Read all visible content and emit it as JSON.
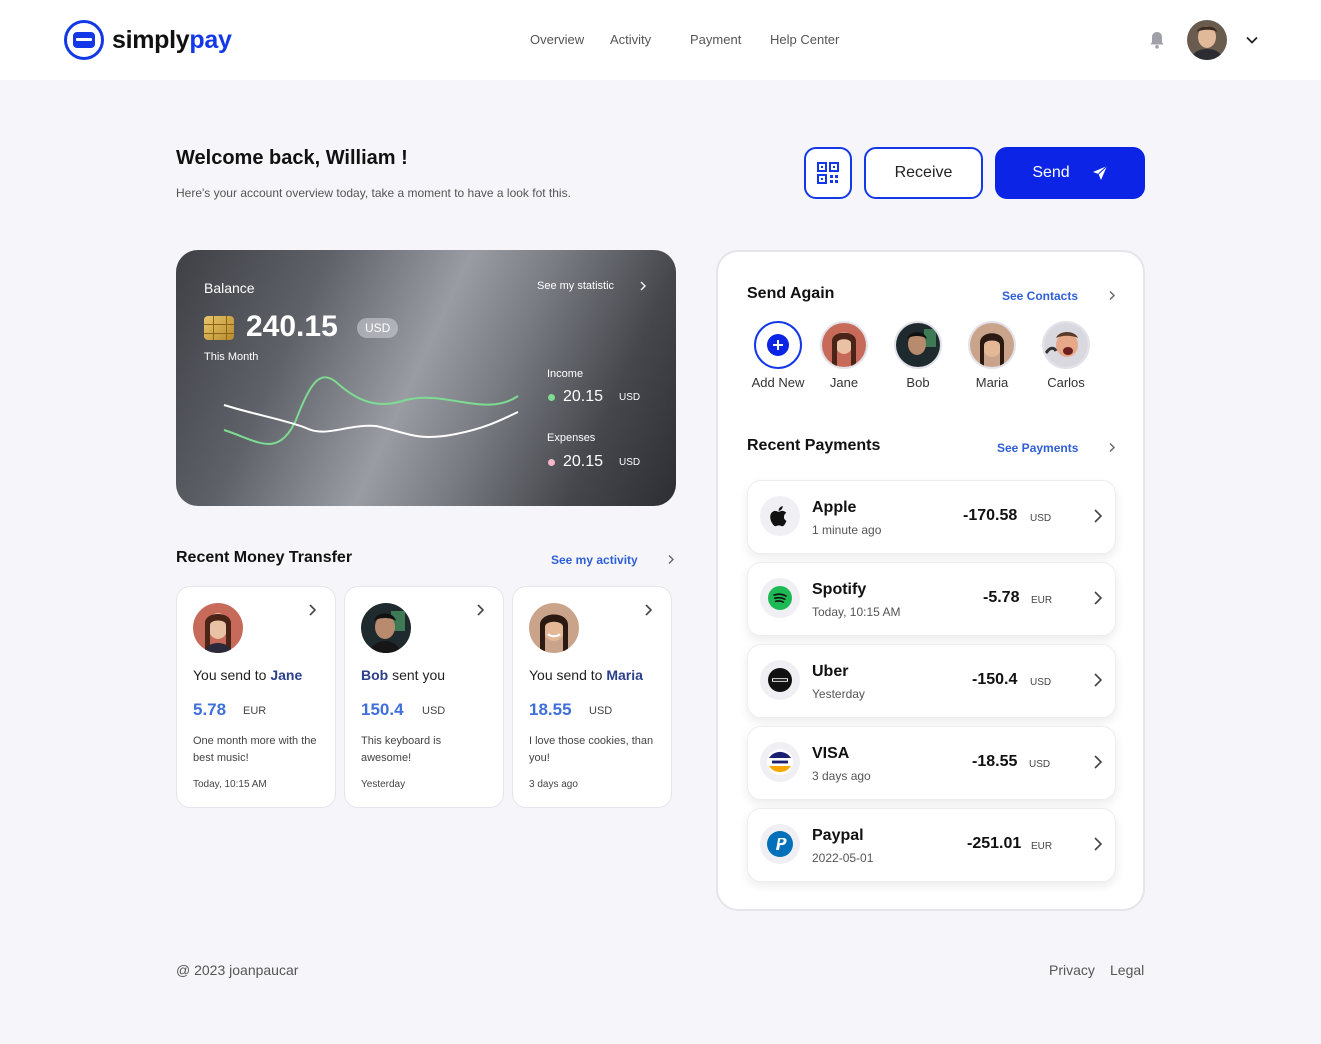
{
  "brand": {
    "part1": "simply",
    "part2": "pay",
    "accent": "#1338e8"
  },
  "nav": {
    "overview": "Overview",
    "activity": "Activity",
    "payment": "Payment",
    "help": "Help Center"
  },
  "header": {
    "welcome": "Welcome back, William !",
    "subtitle": "Here's your account overview today, take a moment to have a look fot this."
  },
  "actions": {
    "receive": "Receive",
    "send": "Send"
  },
  "balance": {
    "label": "Balance",
    "see_stat": "See my statistic",
    "amount": "240.15",
    "currency": "USD",
    "period": "This Month",
    "income_label": "Income",
    "income_value": "20.15",
    "income_currency": "USD",
    "expenses_label": "Expenses",
    "expenses_value": "20.15",
    "expenses_currency": "USD",
    "income_color": "#7ddc92",
    "expenses_color": "#f6b8c8"
  },
  "recent_transfer": {
    "title": "Recent Money Transfer",
    "link": "See my activity",
    "items": [
      {
        "prefix": "You send to ",
        "name": "Jane",
        "suffix": "",
        "amount": "5.78",
        "currency": "EUR",
        "note": "One month more with the best music!",
        "time": "Today, 10:15 AM"
      },
      {
        "prefix": "",
        "name": "Bob",
        "suffix": " sent you",
        "amount": "150.4",
        "currency": "USD",
        "note": "This keyboard is awesome!",
        "time": "Yesterday"
      },
      {
        "prefix": "You send to ",
        "name": "Maria",
        "suffix": "",
        "amount": "18.55",
        "currency": "USD",
        "note": "I love those cookies, than you!",
        "time": "3 days ago"
      }
    ]
  },
  "send_again": {
    "title": "Send Again",
    "link": "See Contacts",
    "contacts": [
      "Add New",
      "Jane",
      "Bob",
      "Maria",
      "Carlos"
    ]
  },
  "recent_payments": {
    "title": "Recent Payments",
    "link": "See Payments",
    "items": [
      {
        "name": "Apple",
        "time": "1 minute ago",
        "value": "-170.58",
        "currency": "USD",
        "icon": "apple-icon"
      },
      {
        "name": "Spotify",
        "time": "Today, 10:15 AM",
        "value": "-5.78",
        "currency": "EUR",
        "icon": "spotify-icon"
      },
      {
        "name": "Uber",
        "time": "Yesterday",
        "value": "-150.4",
        "currency": "USD",
        "icon": "uber-icon"
      },
      {
        "name": "VISA",
        "time": "3 days ago",
        "value": "-18.55",
        "currency": "USD",
        "icon": "visa-icon"
      },
      {
        "name": "Paypal",
        "time": "2022-05-01",
        "value": "-251.01",
        "currency": "EUR",
        "icon": "paypal-icon"
      }
    ]
  },
  "footer": {
    "copyright": "@ 2023 joanpaucar",
    "privacy": "Privacy",
    "legal": "Legal"
  }
}
